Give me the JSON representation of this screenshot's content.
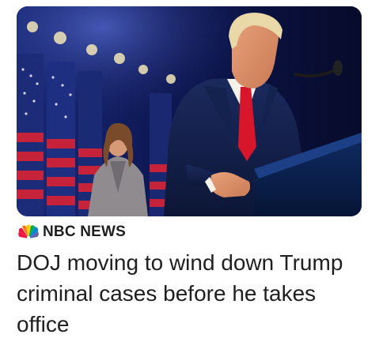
{
  "story": {
    "source_name": "NBC NEWS",
    "source_logo_icon": "nbc-peacock-icon",
    "headline": "DOJ moving to wind down Trump criminal cases before he takes office",
    "thumbnail": "photo-speaker-at-podium-icon"
  },
  "colors": {
    "text": "#1f1f1f",
    "background": "#ffffff",
    "peacock": [
      "#fccc12",
      "#ef1541",
      "#6460aa",
      "#0489d1",
      "#05ac3f",
      "#ff7112"
    ]
  }
}
